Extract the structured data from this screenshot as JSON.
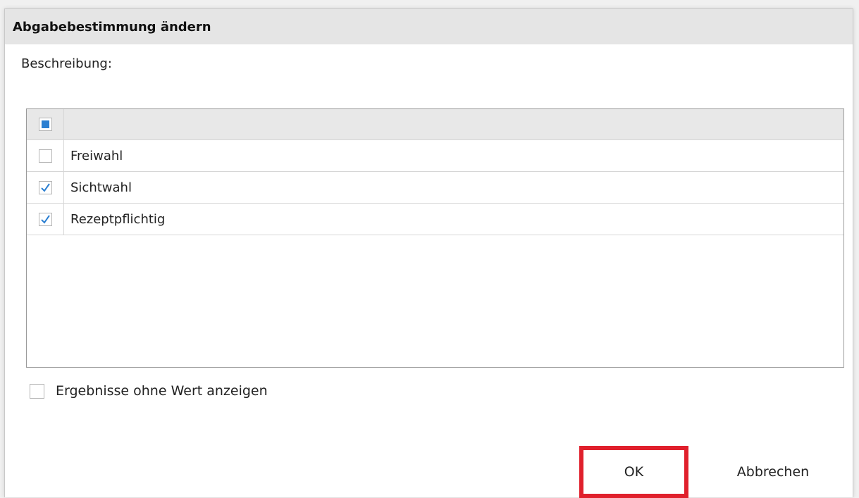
{
  "dialog": {
    "title": "Abgabebestimmung ändern",
    "description_label": "Beschreibung:"
  },
  "list": {
    "header_check_state": "partial",
    "items": [
      {
        "label": "Freiwahl",
        "checked": false
      },
      {
        "label": "Sichtwahl",
        "checked": true
      },
      {
        "label": "Rezeptpflichtig",
        "checked": true
      }
    ]
  },
  "options": {
    "show_empty_label": "Ergebnisse ohne Wert anzeigen",
    "show_empty_checked": false
  },
  "buttons": {
    "ok_label": "OK",
    "cancel_label": "Abbrechen"
  },
  "colors": {
    "accent": "#2b7fd1",
    "highlight_border": "#e0202c",
    "titlebar_bg": "#e5e5e5"
  }
}
